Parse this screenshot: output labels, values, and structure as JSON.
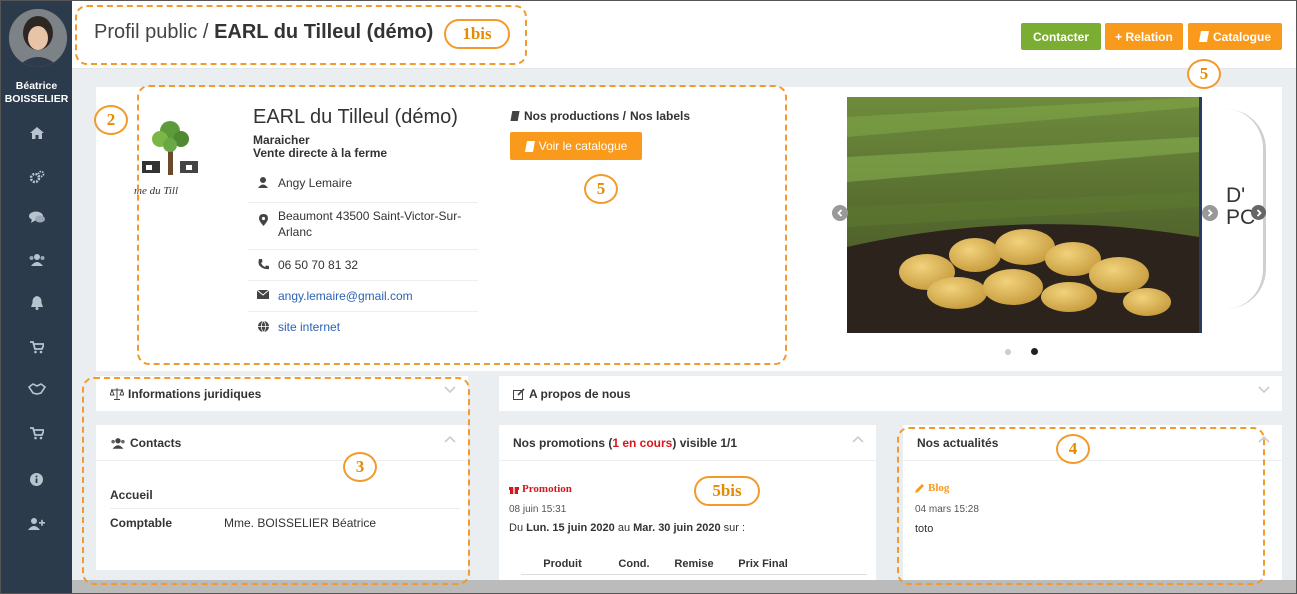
{
  "user": {
    "first_name": "Béatrice",
    "last_name": "BOISSELIER"
  },
  "sidebar": {
    "icons": [
      "home-icon",
      "cogs-icon",
      "comments-icon",
      "users-icon",
      "bell-icon",
      "cart-icon",
      "handshake-icon",
      "cart-plus-icon",
      "info-icon",
      "user-plus-icon"
    ]
  },
  "header": {
    "prefix": "Profil public / ",
    "name": "EARL du Tilleul (démo)",
    "contact_label": "Contacter",
    "relation_label": "+ Relation",
    "catalogue_label": "Catalogue"
  },
  "profile": {
    "name": "EARL du Tilleul (démo)",
    "type": "Maraicher",
    "sale": "Vente directe à la ferme",
    "logo_text": "me du Till",
    "contact_person": "Angy Lemaire",
    "address": "Beaumont 43500 Saint-Victor-Sur-Arlanc",
    "phone": "06 50 70 81 32",
    "email": "angy.lemaire@gmail.com",
    "website": "site internet"
  },
  "productions": {
    "title": "Nos productions / ",
    "labels": "Nos labels",
    "button": "Voir le catalogue"
  },
  "carousel": {
    "peek_text_1": "D'",
    "peek_text_2": "PC",
    "active_dot": 2,
    "dots": 2
  },
  "legal": {
    "title": "Informations juridiques"
  },
  "contacts": {
    "title": "Contacts",
    "rows": [
      {
        "role": "Accueil",
        "name": ""
      },
      {
        "role": "Comptable",
        "name": "Mme. BOISSELIER Béatrice"
      }
    ]
  },
  "about": {
    "title": "A propos de nous"
  },
  "promotions": {
    "title_start": "Nos promotions (",
    "count": "1 en cours",
    "title_end": ") visible 1/1",
    "tag": "Promotion",
    "date": "08 juin 15:31",
    "period_prefix": "Du ",
    "period_start": "Lun. 15 juin 2020",
    "period_mid": " au ",
    "period_end": "Mar. 30 juin 2020",
    "period_suffix": " sur :",
    "columns": [
      "Produit",
      "Cond.",
      "Remise",
      "Prix Final"
    ]
  },
  "news": {
    "title": "Nos actualités",
    "tag": "Blog",
    "date": "04 mars 15:28",
    "text": "toto"
  },
  "annotations": {
    "a1": "1bis",
    "a2": "2",
    "a3": "3",
    "a4": "4",
    "a5a": "5",
    "a5b": "5",
    "a5bis": "5bis"
  },
  "colors": {
    "sidebar": "#2b3b4c",
    "green": "#7cad33",
    "orange": "#f99a1c",
    "annotation": "#f39a2c",
    "red": "#d6171d"
  }
}
